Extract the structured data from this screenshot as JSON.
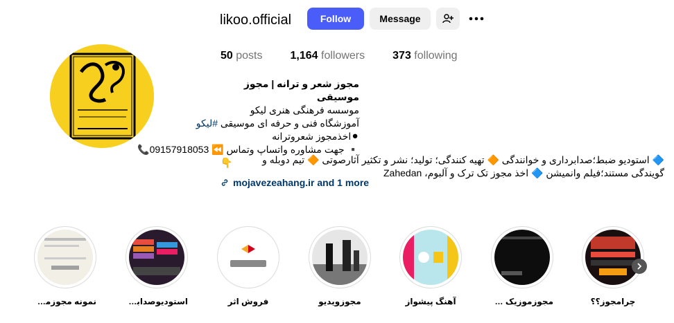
{
  "profile": {
    "username": "likoo.official",
    "follow_label": "Follow",
    "message_label": "Message"
  },
  "stats": {
    "posts_count": "50",
    "posts_label": "posts",
    "followers_count": "1,164",
    "followers_label": "followers",
    "following_count": "373",
    "following_label": "following"
  },
  "bio": {
    "name": "مجوز شعر و ترانه | مجوز موسیقی",
    "line1": "موسسه فرهنگی هنری لیکو",
    "line2_prefix": "آموزشگاه فنی و حرفه ای موسیقی ",
    "line2_hashtag": "#لیکو",
    "line3": "⚫اخذمجوز شعروترانه",
    "line4": "▪️ جهت مشاوره واتساپ وتماس ⏪ 09157918053📞",
    "line5": "👇",
    "line6": "🔷 استودیو ضبط؛صدابرداری و خوانندگی 🔶 تهیه کنندگی؛ تولید؛ نشر و تکثیر آثارصوتی 🔶 تیم دوبله و",
    "line7": "گویندگی مستند؛فیلم وانمیشن 🔷 اخذ مجوز تک ترک و آلبوم، Zahedan"
  },
  "link": {
    "text": "mojavezeahang.ir and 1 more"
  },
  "highlights": [
    {
      "label": "چرامجوز؟؟"
    },
    {
      "label": "مجوزموزیک وی..."
    },
    {
      "label": "آهنگ پیشواز"
    },
    {
      "label": "مجوزویدیو"
    },
    {
      "label": "فروش اثر"
    },
    {
      "label": "استودیوصدابرد..."
    },
    {
      "label": "نمونه مجوزمو..."
    }
  ],
  "icons": {
    "add_user": "add-user-icon",
    "more": "more-horizontal-icon",
    "link": "link-icon",
    "next": "chevron-right-icon"
  },
  "colors": {
    "accent": "#4a5df9",
    "avatar_bg": "#f7cf1e",
    "link": "#00376b"
  }
}
